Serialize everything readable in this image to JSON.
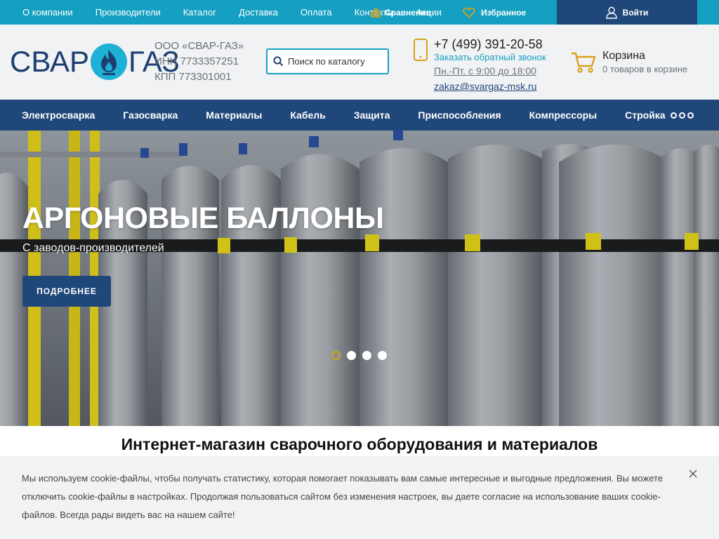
{
  "topnav": {
    "items": [
      "О компании",
      "Производители",
      "Каталог",
      "Доставка",
      "Оплата",
      "Контакты",
      "Акции"
    ],
    "compare_label": "Сравнение",
    "favorites_label": "Избранное",
    "login_label": "Войти"
  },
  "header": {
    "logo_left": "СВАР",
    "logo_right": "ГАЗ",
    "company_name": "ООО «СВАР-ГАЗ»",
    "inn": "ИНН 7733357251",
    "kpp": "КПП 773301001",
    "search_placeholder": "Поиск по каталогу",
    "phone": "+7 (499) 391-20-58",
    "callback": "Заказать обратный звонок",
    "hours": "Пн.-Пт. с 9:00 до 18:00",
    "email": "zakaz@svargaz-msk.ru",
    "cart_title": "Корзина",
    "cart_sub": "0 товаров в корзине"
  },
  "mainnav": {
    "items": [
      "Электросварка",
      "Газосварка",
      "Материалы",
      "Кабель",
      "Защита",
      "Приспособления",
      "Компрессоры",
      "Стройка"
    ]
  },
  "hero": {
    "title": "АРГОНОВЫЕ БАЛЛОНЫ",
    "subtitle": "С заводов-производителей",
    "button": "ПОДРОБНЕЕ",
    "slides_total": 4,
    "active_slide": 1
  },
  "main": {
    "heading": "Интернет-магазин сварочного оборудования и материалов"
  },
  "cookie": {
    "text": "Мы используем cookie-файлы, чтобы получать статистику, которая помогает показывать вам самые интересные и выгодные предложения. Вы можете отключить cookie-файлы в настройках. Продолжая пользоваться сайтом без изменения настроек, вы даете согласие на использование ваших cookie-файлов. Всегда рады видеть вас на нашем сайте!"
  },
  "colors": {
    "topbar": "#15a0c2",
    "navy": "#20477a",
    "accent_yellow": "#d9a21b"
  }
}
